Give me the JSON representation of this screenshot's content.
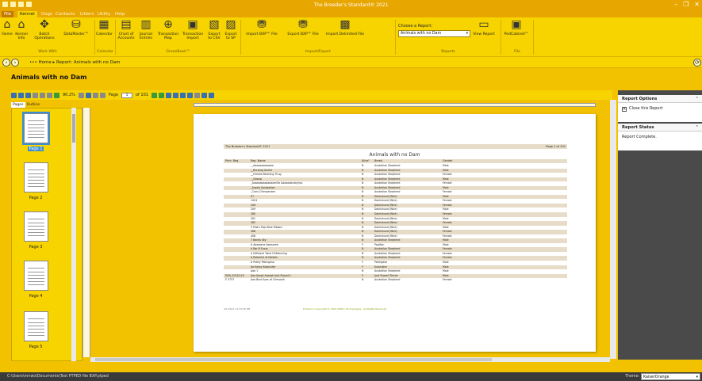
{
  "app": {
    "title": "The Breeder's Standard® 2021"
  },
  "menu": {
    "tabs": [
      {
        "label": "File"
      },
      {
        "label": "Kennel"
      },
      {
        "label": "Dogs"
      },
      {
        "label": "Contacts"
      },
      {
        "label": "Litters"
      },
      {
        "label": "Utility"
      },
      {
        "label": "Help"
      }
    ]
  },
  "ribbon": {
    "buttons": [
      {
        "label": "Home",
        "icon": "home-icon",
        "glyph": "⌂"
      },
      {
        "label": "Kennel Info",
        "icon": "kennel-icon",
        "glyph": "⌂"
      },
      {
        "label": "Batch Operations",
        "icon": "batch-icon",
        "glyph": "✥"
      },
      {
        "label": "DataMaster™",
        "icon": "database-icon",
        "glyph": "⛁"
      },
      {
        "label": "Calendar",
        "icon": "calendar-icon",
        "glyph": "▦"
      },
      {
        "label": "Chart of Accounts",
        "icon": "chart-icon",
        "glyph": "▤"
      },
      {
        "label": "Journal Entries",
        "icon": "journal-icon",
        "glyph": "▥"
      },
      {
        "label": "Transaction Map",
        "icon": "globe-icon",
        "glyph": "⊕"
      },
      {
        "label": "Transaction Import",
        "icon": "import-icon",
        "glyph": "▣"
      },
      {
        "label": "Export to CSV",
        "icon": "csv-icon",
        "glyph": "▧"
      },
      {
        "label": "Export to SP",
        "icon": "sp-icon",
        "glyph": "▨"
      },
      {
        "label": "Import BXP™ File",
        "icon": "import-bxp-icon",
        "glyph": "⛃"
      },
      {
        "label": "Export BXP™ File",
        "icon": "export-bxp-icon",
        "glyph": "⛃"
      },
      {
        "label": "Import Delimited File",
        "icon": "delimited-icon",
        "glyph": "▩"
      },
      {
        "label": "View Report",
        "icon": "report-icon",
        "glyph": "▭"
      },
      {
        "label": "PedCabinet™",
        "icon": "cabinet-icon",
        "glyph": "▣"
      }
    ],
    "groups": [
      {
        "label": "Work With"
      },
      {
        "label": "Calendar"
      },
      {
        "label": "GreenBook™"
      },
      {
        "label": "Import/Export"
      },
      {
        "label": "Reports"
      },
      {
        "label": "File"
      }
    ],
    "report_chooser": {
      "label": "Choose a Report:",
      "value": "Animals with no Dam"
    }
  },
  "breadcrumb": {
    "home": "Home",
    "current": "Report: Animals with no Dam",
    "separator": "▸",
    "more": "•••"
  },
  "page_title": "Animals with no Dam",
  "viewer": {
    "zoom": "90.2%",
    "page_label": "Page",
    "page_value": "1",
    "page_of": "of 101"
  },
  "left_tabs": [
    {
      "label": "Pages"
    },
    {
      "label": "Outline"
    }
  ],
  "thumbnails": [
    {
      "label": "Page 1"
    },
    {
      "label": "Page 2"
    },
    {
      "label": "Page 3"
    },
    {
      "label": "Page 4"
    },
    {
      "label": "Page 5"
    }
  ],
  "report": {
    "header_left": "The Breeder's Standard® 2021",
    "header_right": "Page 1 of 101",
    "title": "Animals with no Dam",
    "columns": [
      "Prim. Reg.",
      "Reg. Name",
      "Alive¹",
      "Breed",
      "Gender"
    ],
    "rows": [
      [
        "",
        "__Aaaaaaaaaaaaa",
        "N",
        "Australian Shepherd",
        "Male"
      ],
      [
        "",
        "__Burping Gorilla",
        "N",
        "Australian Shepherd",
        "Male"
      ],
      [
        "",
        "__Female Belching Thug",
        "N",
        "Australian Shepherd",
        "Female"
      ],
      [
        "",
        "__Gossip",
        "N",
        "Australian Shepherd",
        "Male"
      ],
      [
        "",
        "_Aaaaaaaaaaaaaamlifa Aaaaaabcdxyhyx",
        "N",
        "Australian Shepherd",
        "Female"
      ],
      [
        "",
        "_Aussie Ausbastian",
        "N",
        "Australian Shepherd",
        "Male"
      ],
      [
        "",
        "_Corry Chimpanzee",
        "N",
        "Australian Shepherd",
        "Female"
      ],
      [
        "",
        "07",
        "N",
        "Dachshund (Wire)",
        "Male"
      ],
      [
        "",
        "1424",
        "N",
        "Dachshund (Wire)",
        "Female"
      ],
      [
        "",
        "208",
        "N",
        "Dachshund (Wire)",
        "Female"
      ],
      [
        "",
        "209",
        "N",
        "Dachshund (Wire)",
        "Male"
      ],
      [
        "",
        "260",
        "N",
        "Dachshund (Wire)",
        "Female"
      ],
      [
        "",
        "261",
        "N",
        "Dachshund (Wire)",
        "Male"
      ],
      [
        "",
        "262",
        "N",
        "Dachshund (Wire)",
        "Female"
      ],
      [
        "",
        "3 Paw's Papi Blue Ribbon",
        "N",
        "Dachshund (Wire)",
        "Male"
      ],
      [
        "",
        "368",
        "N",
        "Dachshund (Wire)",
        "Female"
      ],
      [
        "",
        "408",
        "N",
        "Dachshund (Wire)",
        "Female"
      ],
      [
        "",
        "7 Bands Sky",
        "N",
        "Australian Shepherd",
        "Male"
      ],
      [
        "",
        "A Awesome Awesome",
        "Y",
        "Papillon",
        "Male"
      ],
      [
        "",
        "A Bar B Fuzzy",
        "N",
        "Australian Shepherd",
        "Female"
      ],
      [
        "",
        "A Different Twist O'Mdesiring",
        "N",
        "Australian Shepherd",
        "Female"
      ],
      [
        "",
        "A Rubenful of Nickels",
        "N",
        "Australian Shepherd",
        "Female"
      ],
      [
        "",
        "A Pretty Pekingese",
        "Y",
        "Pekingese",
        "Male"
      ],
      [
        "",
        "Aa Kasey Kolonister",
        "Y",
        "Kulonister",
        "Male"
      ],
      [
        "",
        "Aaa 1",
        "N",
        "Australian Shepherd",
        "Male"
      ],
      [
        "DEN_2012/143",
        "Aaa Aargh Aaargh Jack Russell I",
        "Y",
        "Jack Russell Terrier",
        "Male"
      ],
      [
        "E 3757",
        "Aaa Blue Eyes of Crimsonk",
        "N",
        "Australian Shepherd",
        "Female"
      ]
    ],
    "footer_left": "4/1/2021 12:34:06 PM",
    "footer_center": "Printed in Copyright © 2021 PetPro Technologies - All Rights Reserved"
  },
  "panels": {
    "options": {
      "title": "Report Options",
      "close_label": "Close this Report"
    },
    "status": {
      "title": "Report Status",
      "text": "Report Complete."
    }
  },
  "statusbar": {
    "path": "C:\\Users\\mnwo\\Documents\\Test PTPED file BXP.ptped",
    "theme_label": "Theme:",
    "theme_value": "KaiserOrange"
  }
}
